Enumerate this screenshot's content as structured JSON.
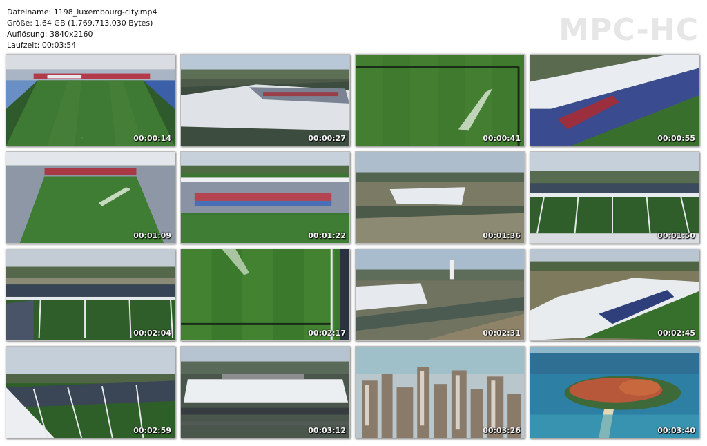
{
  "file_info": {
    "name_line": "Dateiname: 1198_luxembourg-city.mp4",
    "size_line": "Größe: 1,64 GB (1.769.713.030 Bytes)",
    "resolution_line": "Auflösung: 3840x2160",
    "duration_line": "Laufzeit: 00:03:54"
  },
  "brand": "MPC-HC",
  "thumbnails": [
    {
      "time": "00:00:14",
      "scene": "stadium interior wide"
    },
    {
      "time": "00:00:27",
      "scene": "stadium roof aerial"
    },
    {
      "time": "00:00:41",
      "scene": "pitch sprinkler"
    },
    {
      "time": "00:00:55",
      "scene": "stand and roof close"
    },
    {
      "time": "00:01:09",
      "scene": "stadium interior sprinkler"
    },
    {
      "time": "00:01:22",
      "scene": "stands and pitch"
    },
    {
      "time": "00:01:36",
      "scene": "stadium from distance"
    },
    {
      "time": "00:01:50",
      "scene": "truss roof structure"
    },
    {
      "time": "00:02:04",
      "scene": "truss roof structure"
    },
    {
      "time": "00:02:17",
      "scene": "pitch top view"
    },
    {
      "time": "00:02:31",
      "scene": "stadium and roads"
    },
    {
      "time": "00:02:45",
      "scene": "roof corner"
    },
    {
      "time": "00:02:59",
      "scene": "roof edge truss"
    },
    {
      "time": "00:03:12",
      "scene": "stadium front"
    },
    {
      "time": "00:03:26",
      "scene": "city skyscrapers"
    },
    {
      "time": "00:03:40",
      "scene": "island in sea"
    }
  ]
}
